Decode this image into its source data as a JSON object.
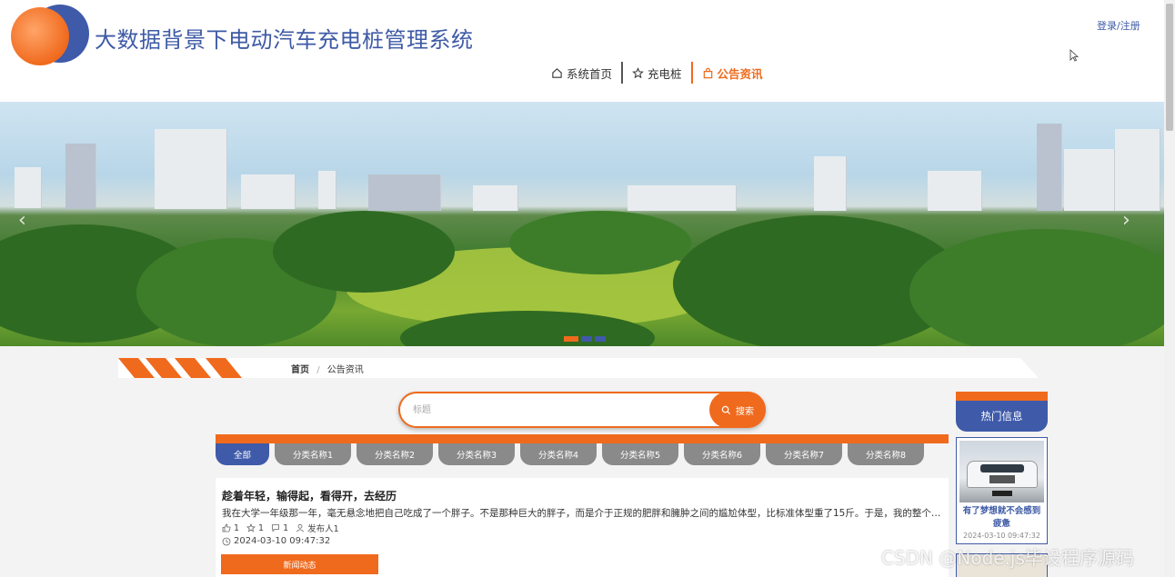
{
  "header": {
    "title": "大数据背景下电动汽车充电桩管理系统",
    "login": "登录/注册",
    "nav": [
      {
        "label": "系统首页",
        "icon": "home-icon"
      },
      {
        "label": "充电桩",
        "icon": "star-icon"
      },
      {
        "label": "公告资讯",
        "icon": "bag-icon",
        "active": true
      }
    ]
  },
  "banner": {
    "prev": "‹",
    "next": "›",
    "slide_count": 3,
    "active_slide": 1
  },
  "breadcrumb": {
    "home": "首页",
    "separator": "/",
    "current": "公告资讯"
  },
  "search": {
    "placeholder": "标题",
    "value": "",
    "button": "搜索"
  },
  "categories": [
    "全部",
    "分类名称1",
    "分类名称2",
    "分类名称3",
    "分类名称4",
    "分类名称5",
    "分类名称6",
    "分类名称7",
    "分类名称8"
  ],
  "news": {
    "title": "趁着年轻，输得起，看得开，去经历",
    "desc": "我在大学一年级那一年，毫无悬念地把自己吃成了一个胖子。不是那种巨大的胖子，而是介于正规的肥胖和臃肿之间的尴尬体型，比标准体型重了15斤。于是，我的整个大学生...",
    "likes": "1",
    "favorites": "1",
    "comments": "1",
    "publisher": "发布人1",
    "time": "2024-03-10 09:47:32",
    "tag": "新闻动态"
  },
  "hot": {
    "heading": "热门信息",
    "item": {
      "title": "有了梦想就不会感到疲惫",
      "time": "2024-03-10 09:47:32"
    }
  },
  "watermark": "CSDN @Node.js毕设程序源码",
  "colors": {
    "brand_blue": "#3f5aa9",
    "brand_orange": "#f06a1d"
  }
}
